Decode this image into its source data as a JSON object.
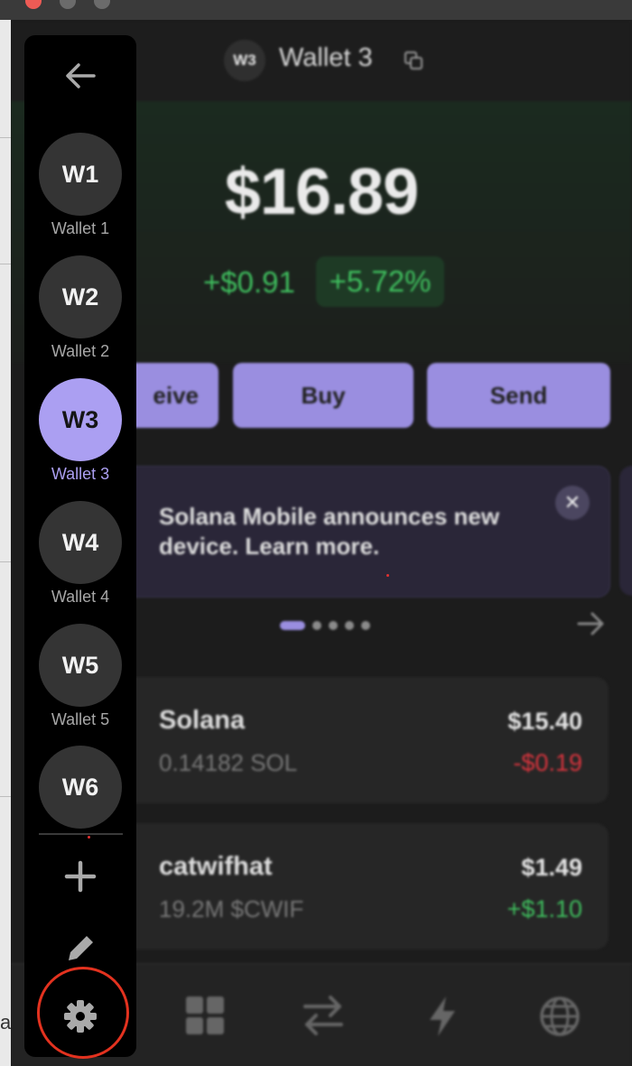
{
  "header": {
    "wallet_badge": "W3",
    "wallet_name": "Wallet 3"
  },
  "balance": {
    "total": "$16.89",
    "change_usd": "+$0.91",
    "change_pct": "+5.72%"
  },
  "actions": {
    "receive": "eive",
    "buy": "Buy",
    "send": "Send"
  },
  "promo": {
    "text": "Solana Mobile announces new device. Learn more.",
    "close": "✕",
    "active_slide": 1,
    "slide_count": 5
  },
  "tokens": [
    {
      "name": "Solana",
      "amount": "0.14182 SOL",
      "value": "$15.40",
      "change": "-$0.19"
    },
    {
      "name": "catwifhat",
      "amount": "19.2M $CWIF",
      "value": "$1.49",
      "change": "+$1.10"
    }
  ],
  "sidebar": {
    "wallets": [
      {
        "badge": "W1",
        "label": "Wallet 1"
      },
      {
        "badge": "W2",
        "label": "Wallet 2"
      },
      {
        "badge": "W3",
        "label": "Wallet 3"
      },
      {
        "badge": "W4",
        "label": "Wallet 4"
      },
      {
        "badge": "W5",
        "label": "Wallet 5"
      },
      {
        "badge": "W6",
        "label": ""
      }
    ],
    "active_index": 2,
    "icons": [
      "back-arrow-icon",
      "plus-icon",
      "pencil-icon",
      "gear-icon"
    ]
  },
  "bottom_nav": {
    "icons": [
      "grid-icon",
      "swap-icon",
      "lightning-icon",
      "globe-icon"
    ]
  },
  "background": {
    "stray_text": "a"
  },
  "colors": {
    "accent": "#ab9ff2",
    "positive": "#3fbe5e",
    "negative": "#d8343d",
    "highlight_ring": "#e3321f"
  }
}
